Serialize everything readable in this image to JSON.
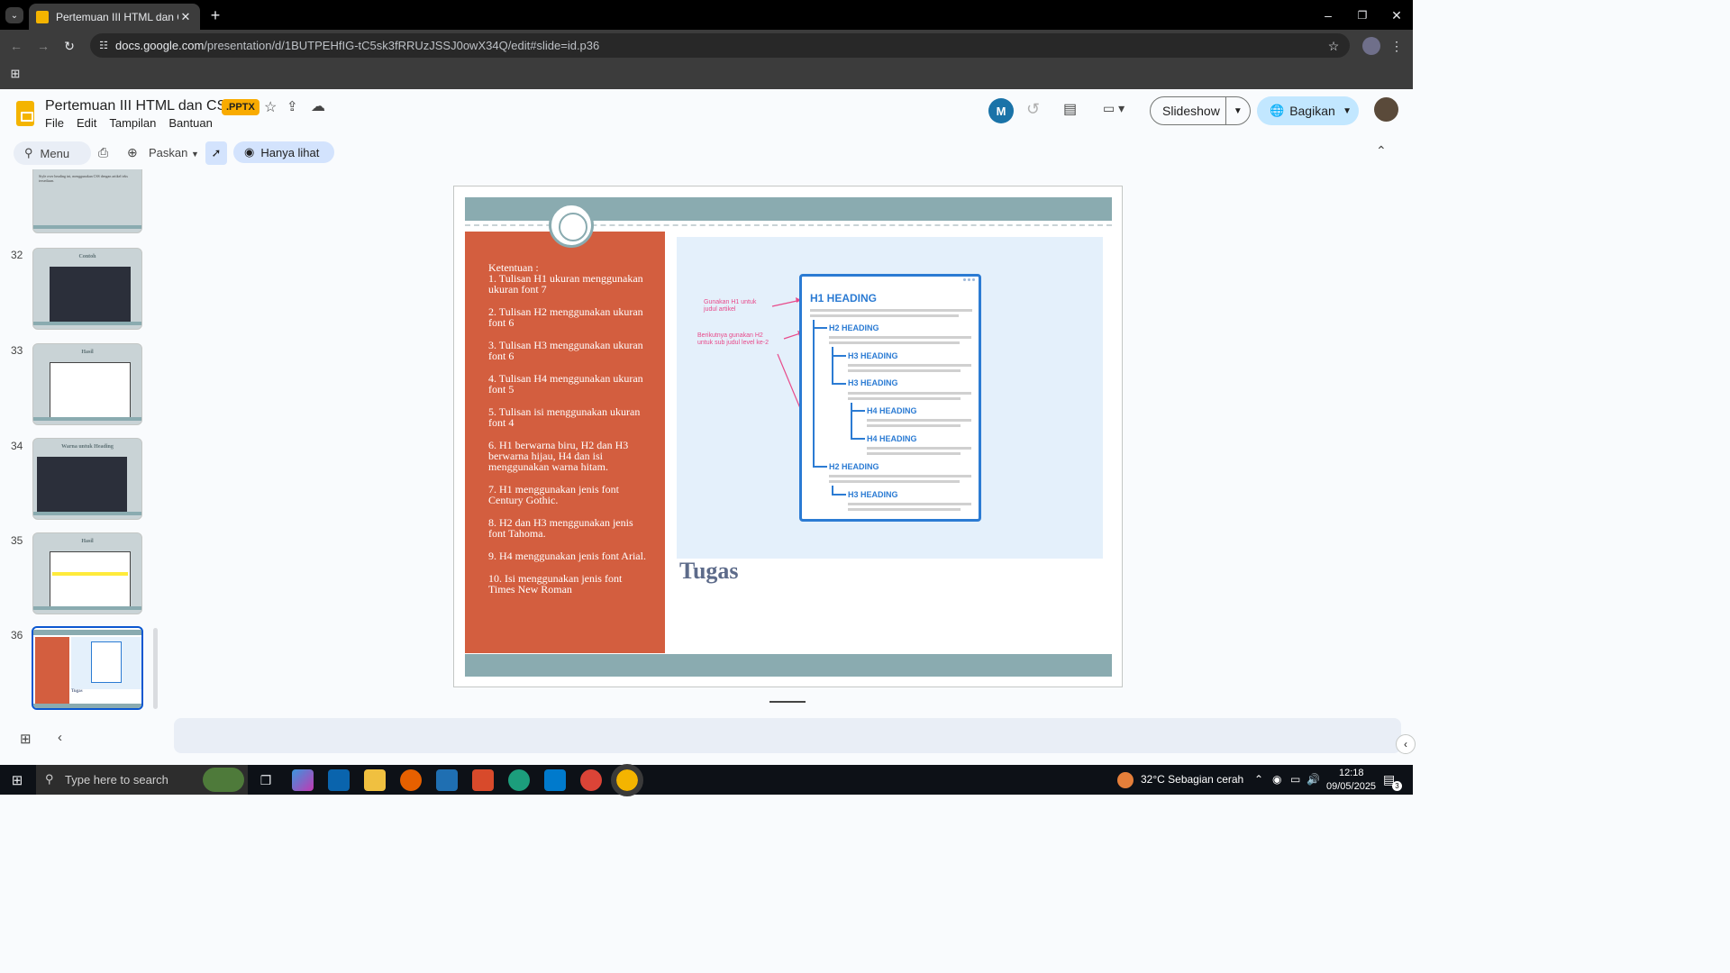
{
  "browser": {
    "tab_title": "Pertemuan III HTML dan CSS.pp",
    "url_host": "docs.google.com",
    "url_path": "/presentation/d/1BUTPEHfIG-tC5sk3fRRUzJSSJ0owX34Q/edit#slide=id.p36"
  },
  "app": {
    "doc_title": "Pertemuan III HTML dan CSS",
    "badge": ".PPTX",
    "menus": [
      "File",
      "Edit",
      "Tampilan",
      "Bantuan"
    ],
    "slideshow_label": "Slideshow",
    "share_label": "Bagikan"
  },
  "toolbar": {
    "menu_search": "Menu",
    "zoom_label": "Paskan",
    "view_only_label": "Hanya lihat"
  },
  "filmstrip": {
    "top_thumb_text": "Style over heading ini, menggunakan CSS dengan artikel teks tersediaan.",
    "thumbs": [
      {
        "num": "32",
        "title": "Contoh"
      },
      {
        "num": "33",
        "title": "Hasil"
      },
      {
        "num": "34",
        "title": "Warna untuk Heading"
      },
      {
        "num": "35",
        "title": "Hasil"
      },
      {
        "num": "36",
        "title": ""
      }
    ]
  },
  "slide": {
    "items": [
      "Ketentuan :\n1. Tulisan H1 ukuran menggunakan ukuran font 7",
      "2. Tulisan H2 menggunakan ukuran font 6",
      "3. Tulisan H3 menggunakan ukuran font 6",
      "4.  Tulisan H4 menggunakan ukuran font 5",
      "5. Tulisan isi menggunakan ukuran font 4",
      "6. H1 berwarna biru, H2 dan H3 berwarna hijau, H4 dan isi menggunakan warna hitam.",
      "7. H1 menggunakan jenis font Century Gothic.",
      "8. H2 dan H3 menggunakan jenis font Tahoma.",
      "9.  H4 menggunakan jenis font Arial.",
      "10. Isi menggunakan jenis font Times New Roman"
    ],
    "title": "Tugas",
    "diagram": {
      "h1": "H1 HEADING",
      "h2a": "H2 HEADING",
      "h3a": "H3 HEADING",
      "h3b": "H3 HEADING",
      "h4a": "H4 HEADING",
      "h4b": "H4 HEADING",
      "h2b": "H2 HEADING",
      "h3c": "H3 HEADING",
      "note1": "Gunakan H1 untuk\njudul artikel",
      "note2": "Berikutnya gunakan H2\nuntuk sub judul level ke-2"
    }
  },
  "taskbar": {
    "search_placeholder": "Type here to search",
    "weather": "32°C  Sebagian cerah",
    "time": "12:18",
    "date": "09/05/2025",
    "notif_count": "3"
  },
  "colors": {
    "accent_panel": "#d35e3f",
    "slide_band": "#8aabb0",
    "heading_blue": "#2b7bd3",
    "share_bg": "#c2e7ff"
  }
}
